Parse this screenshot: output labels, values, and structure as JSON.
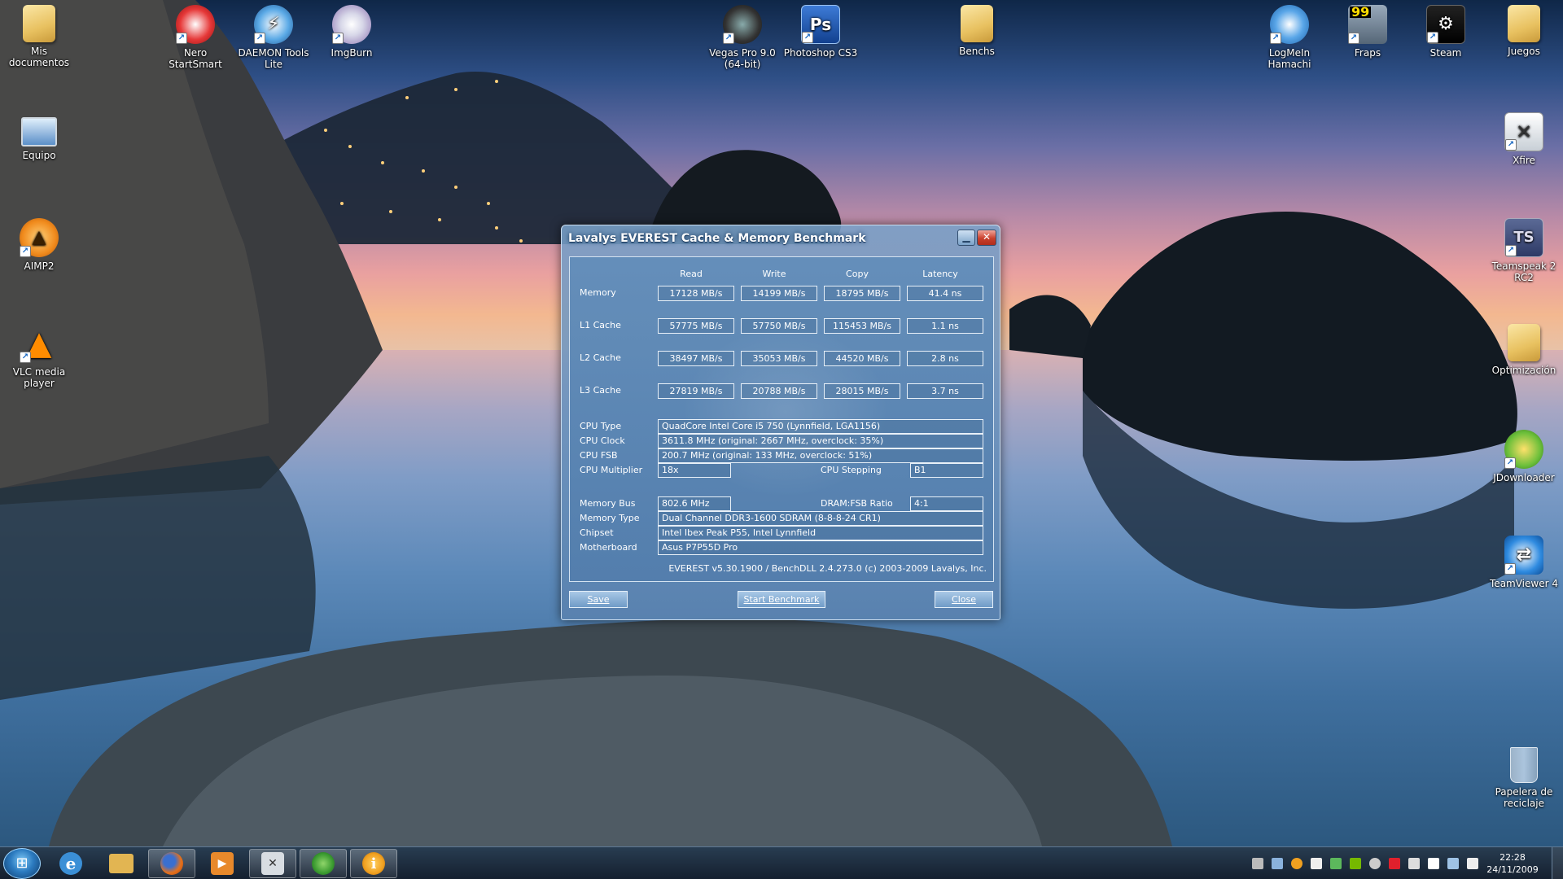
{
  "desktop": {
    "icons": [
      {
        "label": "Mis documentos",
        "icon": "documents-folder-icon"
      },
      {
        "label": "Nero StartSmart",
        "icon": "nero-icon"
      },
      {
        "label": "DAEMON Tools Lite",
        "icon": "daemon-tools-icon"
      },
      {
        "label": "ImgBurn",
        "icon": "imgburn-icon"
      },
      {
        "label": "Vegas Pro 9.0 (64-bit)",
        "icon": "vegas-pro-icon"
      },
      {
        "label": "Photoshop CS3",
        "icon": "photoshop-icon",
        "glyph": "Ps"
      },
      {
        "label": "Benchs",
        "icon": "folder-icon"
      },
      {
        "label": "LogMeIn Hamachi",
        "icon": "hamachi-icon"
      },
      {
        "label": "Fraps",
        "icon": "fraps-icon",
        "glyph": "99"
      },
      {
        "label": "Steam",
        "icon": "steam-icon"
      },
      {
        "label": "Juegos",
        "icon": "folder-icon"
      },
      {
        "label": "Equipo",
        "icon": "computer-icon"
      },
      {
        "label": "AIMP2",
        "icon": "aimp-icon"
      },
      {
        "label": "VLC media player",
        "icon": "vlc-icon"
      },
      {
        "label": "Xfire",
        "icon": "xfire-icon"
      },
      {
        "label": "Teamspeak 2 RC2",
        "icon": "teamspeak-icon",
        "glyph": "TS"
      },
      {
        "label": "Optimización",
        "icon": "folder-icon"
      },
      {
        "label": "JDownloader",
        "icon": "jdownloader-icon"
      },
      {
        "label": "TeamViewer 4",
        "icon": "teamviewer-icon"
      },
      {
        "label": "Papelera de reciclaje",
        "icon": "recycle-bin-icon"
      }
    ]
  },
  "dialog": {
    "title": "Lavalys EVEREST Cache & Memory Benchmark",
    "columns": [
      "Read",
      "Write",
      "Copy",
      "Latency"
    ],
    "rows": [
      {
        "label": "Memory",
        "values": [
          "17128 MB/s",
          "14199 MB/s",
          "18795 MB/s",
          "41.4 ns"
        ]
      },
      {
        "label": "L1 Cache",
        "values": [
          "57775 MB/s",
          "57750 MB/s",
          "115453 MB/s",
          "1.1 ns"
        ]
      },
      {
        "label": "L2 Cache",
        "values": [
          "38497 MB/s",
          "35053 MB/s",
          "44520 MB/s",
          "2.8 ns"
        ]
      },
      {
        "label": "L3 Cache",
        "values": [
          "27819 MB/s",
          "20788 MB/s",
          "28015 MB/s",
          "3.7 ns"
        ]
      }
    ],
    "info": {
      "cpu_type": {
        "label": "CPU Type",
        "value": "QuadCore Intel Core i5 750  (Lynnfield, LGA1156)"
      },
      "cpu_clock": {
        "label": "CPU Clock",
        "value": "3611.8 MHz  (original: 2667 MHz, overclock: 35%)"
      },
      "cpu_fsb": {
        "label": "CPU FSB",
        "value": "200.7 MHz  (original: 133 MHz, overclock: 51%)"
      },
      "cpu_multiplier": {
        "label": "CPU Multiplier",
        "value": "18x"
      },
      "cpu_stepping": {
        "label": "CPU Stepping",
        "value": "B1"
      },
      "memory_bus": {
        "label": "Memory Bus",
        "value": "802.6 MHz"
      },
      "dram_fsb_ratio": {
        "label": "DRAM:FSB Ratio",
        "value": "4:1"
      },
      "memory_type": {
        "label": "Memory Type",
        "value": "Dual Channel DDR3-1600 SDRAM  (8-8-8-24 CR1)"
      },
      "chipset": {
        "label": "Chipset",
        "value": "Intel Ibex Peak P55, Intel Lynnfield"
      },
      "motherboard": {
        "label": "Motherboard",
        "value": "Asus P7P55D Pro"
      }
    },
    "copyright": "EVEREST v5.30.1900 / BenchDLL 2.4.273.0  (c) 2003-2009 Lavalys, Inc.",
    "buttons": {
      "save": "Save",
      "start": "Start Benchmark",
      "close": "Close"
    }
  },
  "taskbar": {
    "pinned": [
      {
        "icon": "internet-explorer-icon",
        "glyph": "e",
        "color": "#3b8fd6"
      },
      {
        "icon": "explorer-folder-icon",
        "glyph": "",
        "color": "#e2b552"
      },
      {
        "icon": "firefox-icon",
        "glyph": "",
        "color": "#e5711c"
      },
      {
        "icon": "media-player-icon",
        "glyph": "▶",
        "color": "#e8892b"
      },
      {
        "icon": "xfire-icon",
        "glyph": "✕",
        "color": "#9aa7b4"
      },
      {
        "icon": "messenger-icon",
        "glyph": "",
        "color": "#5cb85c"
      },
      {
        "icon": "everest-icon",
        "glyph": "i",
        "color": "#f0a020"
      }
    ],
    "clock": {
      "time": "22:28",
      "date": "24/11/2009"
    },
    "tray_icons": [
      "network-icon",
      "monitor-icon",
      "info-icon",
      "app-icon",
      "green-icon",
      "nvidia-icon",
      "refresh-icon",
      "ati-icon",
      "usb-icon",
      "flag-icon",
      "network-status-icon",
      "volume-icon"
    ]
  }
}
